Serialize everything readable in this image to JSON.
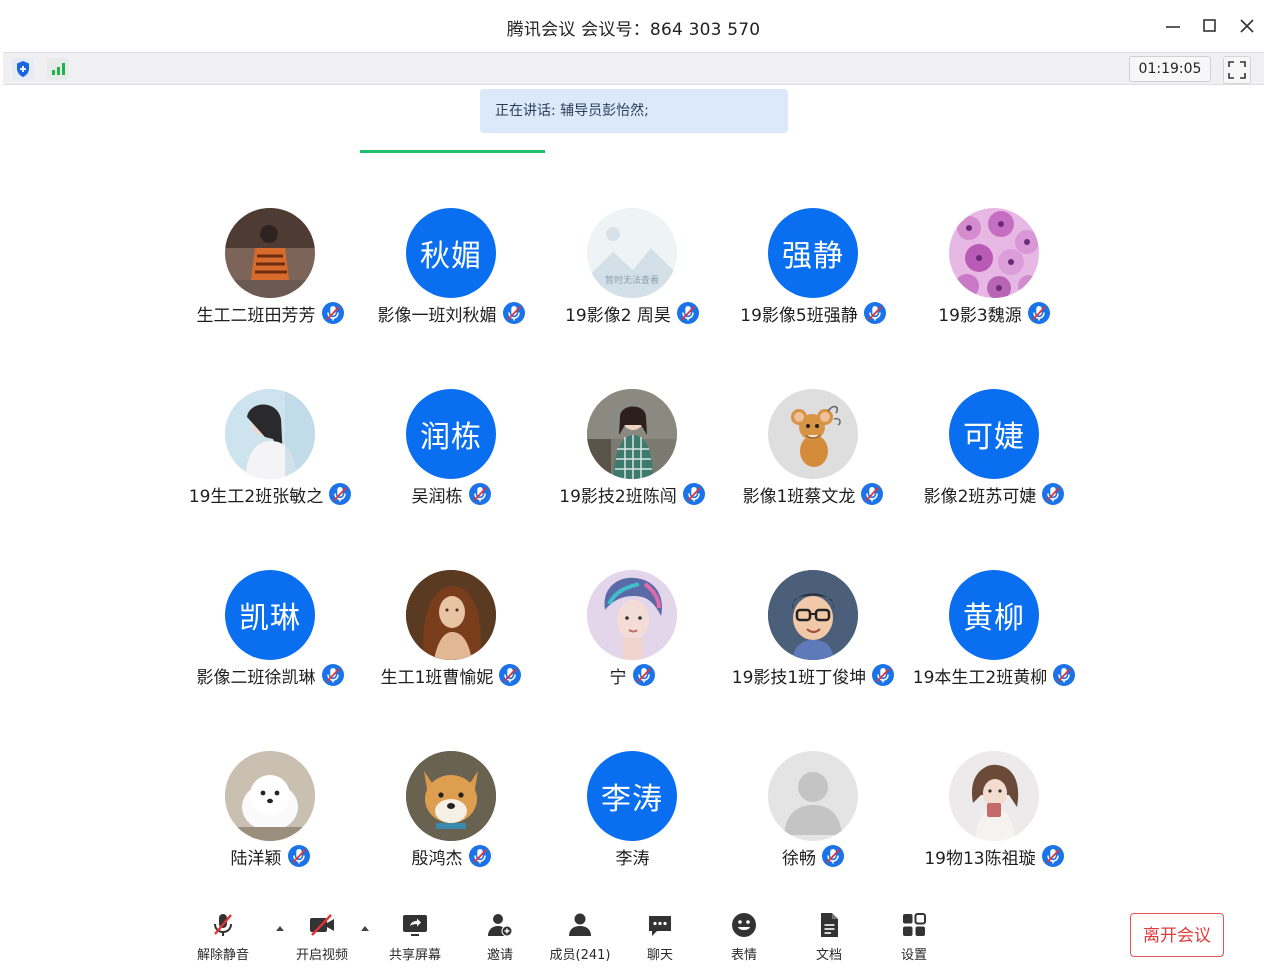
{
  "window": {
    "title": "腾讯会议 会议号：864 303 570",
    "controls": [
      "minimize-icon",
      "maximize-icon",
      "close-icon"
    ]
  },
  "status": {
    "timer": "01:19:05",
    "icons": [
      "shield-icon",
      "signal-icon",
      "fullscreen-icon"
    ],
    "accent": "#1fbf6a"
  },
  "speaking": {
    "text": "正在讲话: 辅导员彭怡然;"
  },
  "participants": [
    {
      "name": "生工二班田芳芳",
      "avatar_text": "",
      "avatar": "photo-person-orange"
    },
    {
      "name": "影像一班刘秋媚",
      "avatar_text": "秋媚",
      "avatar": "text"
    },
    {
      "name": "19影像2 周昊",
      "avatar_text": "",
      "avatar": "placeholder-unavailable",
      "avatar_caption": "暂时无法查看"
    },
    {
      "name": "19影像5班强静",
      "avatar_text": "强静",
      "avatar": "text"
    },
    {
      "name": "19影3魏源",
      "avatar_text": "",
      "avatar": "photo-cells-pink"
    },
    {
      "name": "19生工2班张敏之",
      "avatar_text": "",
      "avatar": "photo-woman-white"
    },
    {
      "name": "吴润栋",
      "avatar_text": "润栋",
      "avatar": "text"
    },
    {
      "name": "19影技2班陈闯",
      "avatar_text": "",
      "avatar": "photo-girl-plaid"
    },
    {
      "name": "影像1班蔡文龙",
      "avatar_text": "",
      "avatar": "cartoon-mouse"
    },
    {
      "name": "影像2班苏可婕",
      "avatar_text": "可婕",
      "avatar": "text"
    },
    {
      "name": "影像二班徐凯琳",
      "avatar_text": "凯琳",
      "avatar": "text"
    },
    {
      "name": "生工1班曹愉妮",
      "avatar_text": "",
      "avatar": "painting-woman"
    },
    {
      "name": "宁",
      "avatar_text": "",
      "avatar": "photo-man-colorful"
    },
    {
      "name": "19影技1班丁俊坤",
      "avatar_text": "",
      "avatar": "cartoon-boy-glasses"
    },
    {
      "name": "19本生工2班黄柳",
      "avatar_text": "黄柳",
      "avatar": "text"
    },
    {
      "name": "陆洋颖",
      "avatar_text": "",
      "avatar": "photo-white-puppy"
    },
    {
      "name": "殷鸿杰",
      "avatar_text": "",
      "avatar": "photo-shiba-dog"
    },
    {
      "name": "李涛",
      "avatar_text": "李涛",
      "avatar": "text",
      "no_mic": true
    },
    {
      "name": "徐畅",
      "avatar_text": "",
      "avatar": "default-person"
    },
    {
      "name": "19物13陈祖璇",
      "avatar_text": "",
      "avatar": "photo-girl-cup"
    }
  ],
  "toolbar": {
    "unmute": "解除静音",
    "video": "开启视频",
    "share": "共享屏幕",
    "invite": "邀请",
    "members": "成员(241)",
    "chat": "聊天",
    "emoji": "表情",
    "docs": "文档",
    "settings": "设置",
    "leave": "离开会议"
  },
  "colors": {
    "avatar_blue": "#0a6ef0",
    "mic_blue": "#1a73e8",
    "leave_red": "#e23b3b",
    "muted_red": "#e03434"
  }
}
